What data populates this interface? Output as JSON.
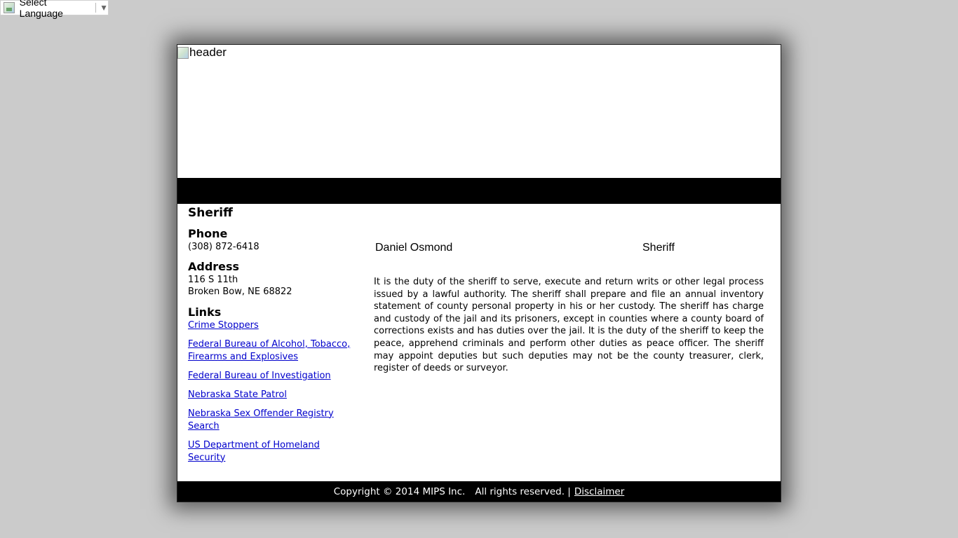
{
  "language_selector": {
    "label": "Select Language",
    "arrow": "▼"
  },
  "header": {
    "image_alt": "header"
  },
  "sidebar": {
    "title": "Sheriff",
    "phone_heading": "Phone",
    "phone": "(308) 872-6418",
    "address_heading": "Address",
    "address_line1": "116 S 11th",
    "address_line2": "Broken Bow, NE 68822",
    "links_heading": "Links",
    "links": [
      {
        "label": "Crime Stoppers"
      },
      {
        "label": "Federal Bureau of Alcohol, Tobacco, Firearms and Explosives"
      },
      {
        "label": "Federal Bureau of Investigation"
      },
      {
        "label": "Nebraska State Patrol"
      },
      {
        "label": "Nebraska Sex Offender Registry Search"
      },
      {
        "label": "US Department of Homeland Security"
      }
    ]
  },
  "main": {
    "staff_name": "Daniel Osmond",
    "staff_title": "Sheriff",
    "description": "It is the duty of the sheriff to serve, execute and return writs or other legal process issued by a lawful authority. The sheriff shall prepare and file an annual inventory statement of county personal property in his or her custody. The sheriff has charge and custody of the jail and its prisoners, except in counties where a county board of corrections exists and has duties over the jail. It is the duty of the sheriff to keep the peace, apprehend criminals and perform other duties as peace officer. The sheriff may appoint deputies but such deputies may not be the county treasurer, clerk, register of deeds or surveyor."
  },
  "footer": {
    "copyright": "Copyright © 2014 MIPS Inc.",
    "rights": "All rights reserved. |",
    "disclaimer": "Disclaimer"
  },
  "colors": {
    "page_background": "#cbcbcb",
    "bar_black": "#000000",
    "link_blue": "#0000cc"
  },
  "icons": [
    "broken-image-icon",
    "dropdown-arrow-icon"
  ]
}
